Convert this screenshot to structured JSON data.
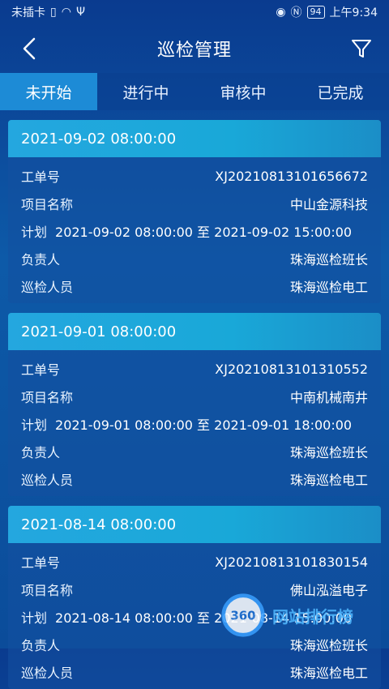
{
  "status_bar": {
    "carrier": "未插卡",
    "battery": "94",
    "time": "上午9:34"
  },
  "nav": {
    "title": "巡检管理"
  },
  "tabs": [
    {
      "label": "未开始",
      "active": true
    },
    {
      "label": "进行中",
      "active": false
    },
    {
      "label": "审核中",
      "active": false
    },
    {
      "label": "已完成",
      "active": false
    }
  ],
  "labels": {
    "order_no": "工单号",
    "project": "项目名称",
    "plan": "计划",
    "owner": "负责人",
    "inspector": "巡检人员",
    "to": "至"
  },
  "cards": [
    {
      "header_time": "2021-09-02 08:00:00",
      "order_no": "XJ20210813101656672",
      "project": "中山金源科技",
      "plan_start": "2021-09-02 08:00:00",
      "plan_end": "2021-09-02 15:00:00",
      "owner": "珠海巡检班长",
      "inspector": "珠海巡检电工"
    },
    {
      "header_time": "2021-09-01 08:00:00",
      "order_no": "XJ20210813101310552",
      "project": "中南机械南井",
      "plan_start": "2021-09-01 08:00:00",
      "plan_end": "2021-09-01 18:00:00",
      "owner": "珠海巡检班长",
      "inspector": "珠海巡检电工"
    },
    {
      "header_time": "2021-08-14 08:00:00",
      "order_no": "XJ20210813101830154",
      "project": "佛山泓溢电子",
      "plan_start": "2021-08-14 08:00:00",
      "plan_end": "2021-08-14 15:00:00",
      "owner": "珠海巡检班长",
      "inspector": "珠海巡检电工"
    }
  ],
  "watermark": {
    "logo_text": "360",
    "site_text": "网站排行榜"
  }
}
